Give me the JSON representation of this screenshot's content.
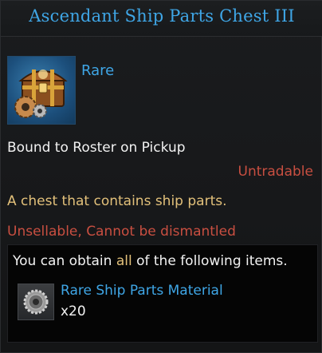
{
  "tooltip": {
    "title": "Ascendant Ship Parts Chest III",
    "item_icon": "treasure-chest-with-gears-icon",
    "rarity": "Rare",
    "bound": "Bound to Roster on Pickup",
    "tradability": "Untradable",
    "description": "A chest that contains ship parts.",
    "restrictions": {
      "first": "Unsellable",
      "separator": ",",
      "second": "Cannot be dismantled"
    },
    "contents": {
      "intro_before": "You can obtain ",
      "intro_highlight": "all",
      "intro_after": " of the following items.",
      "items": [
        {
          "icon": "gear-icon",
          "name": "Rare Ship Parts Material",
          "quantity": "x20"
        }
      ]
    },
    "colors": {
      "title": "#3fa6e6",
      "rare": "#3fa6e6",
      "warning": "#c94f41",
      "description": "#e2c07a"
    }
  }
}
